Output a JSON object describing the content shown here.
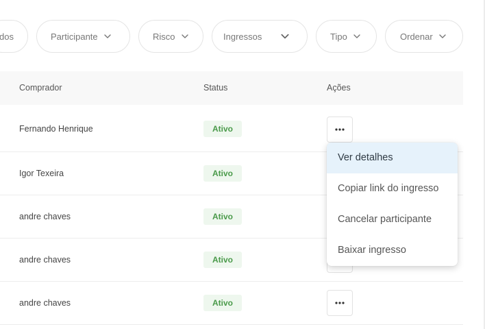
{
  "filters": [
    {
      "label": "dos"
    },
    {
      "label": "Participante"
    },
    {
      "label": "Risco"
    },
    {
      "label": "Ingressos"
    },
    {
      "label": "Tipo"
    },
    {
      "label": "Ordenar"
    }
  ],
  "table": {
    "headers": {
      "buyer": "Comprador",
      "status": "Status",
      "actions": "Ações"
    },
    "rows": [
      {
        "buyer": "Fernando Henrique",
        "status": "Ativo"
      },
      {
        "buyer": "Igor Texeira",
        "status": "Ativo"
      },
      {
        "buyer": "andre chaves",
        "status": "Ativo"
      },
      {
        "buyer": "andre chaves",
        "status": "Ativo"
      },
      {
        "buyer": "andre chaves",
        "status": "Ativo"
      }
    ]
  },
  "actions_menu": {
    "items": [
      {
        "label": "Ver detalhes"
      },
      {
        "label": "Copiar link do ingresso"
      },
      {
        "label": "Cancelar participante"
      },
      {
        "label": "Baixar ingresso"
      }
    ]
  },
  "icons": {
    "chevron": "chevron-down-icon",
    "more": "ellipsis-horizontal-icon"
  },
  "colors": {
    "status_text": "#4a9a4a",
    "status_bg": "#eef7ee",
    "menu_highlight": "#e6f2fb"
  }
}
